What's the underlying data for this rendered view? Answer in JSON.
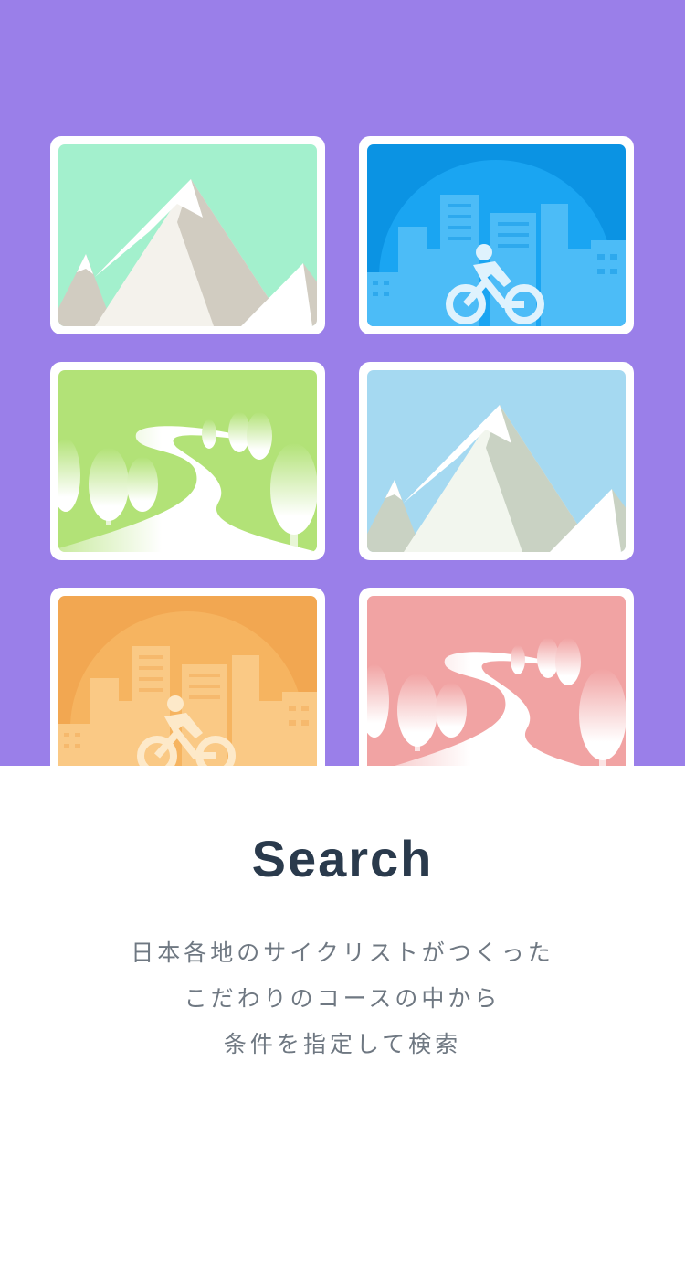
{
  "colors": {
    "background": "#9a7fe9",
    "title": "#2a3a4c",
    "description": "#6f7882",
    "card_border": "#ffffff"
  },
  "cards": [
    {
      "scene": "mountain",
      "sky": "#a3f0cd"
    },
    {
      "scene": "city-cycling",
      "sky": "#0b93e3"
    },
    {
      "scene": "path-trees",
      "sky": "#b2e277"
    },
    {
      "scene": "mountain",
      "sky": "#a5d9f1"
    },
    {
      "scene": "city-cycling",
      "sky": "#f2a751"
    },
    {
      "scene": "path-trees",
      "sky": "#f1a3a3"
    }
  ],
  "title": "Search",
  "description": [
    "日本各地のサイクリストがつくった",
    "こだわりのコースの中から",
    "条件を指定して検索"
  ]
}
